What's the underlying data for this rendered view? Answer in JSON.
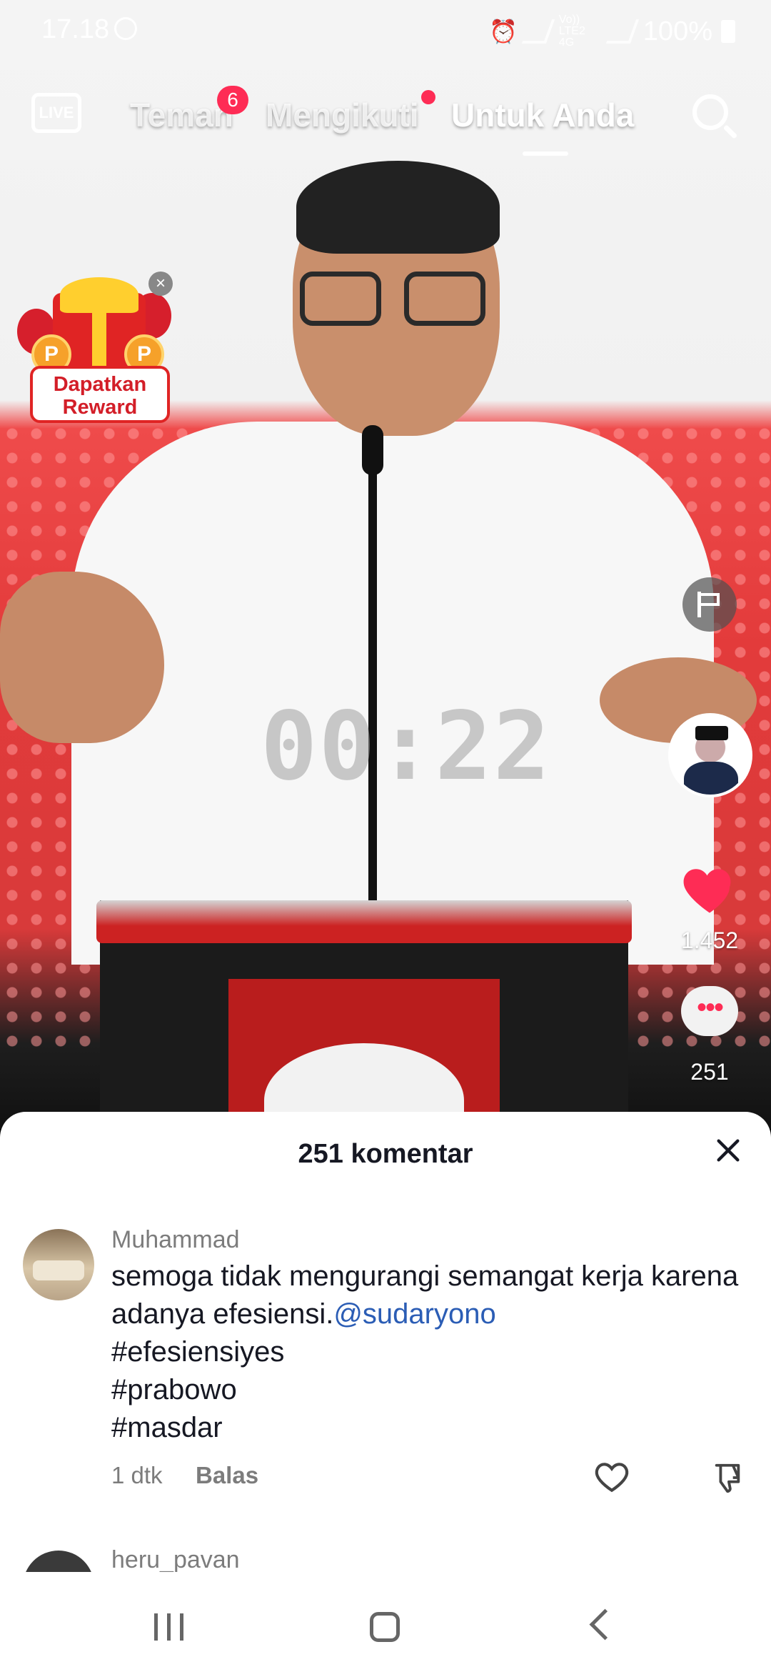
{
  "status_bar": {
    "time": "17.18",
    "network": "Vo)) LTE2 4G",
    "battery": "100%"
  },
  "top_nav": {
    "live_label": "LIVE",
    "tabs": [
      {
        "label": "Teman",
        "badge": "6"
      },
      {
        "label": "Mengikuti"
      },
      {
        "label": "Untuk Anda",
        "active": true
      }
    ]
  },
  "reward": {
    "line1": "Dapatkan",
    "line2": "Reward",
    "coin": "P"
  },
  "video": {
    "timer": "00:22",
    "likes": "1.452",
    "comments": "251"
  },
  "comments_sheet": {
    "title": "251 komentar",
    "comments": [
      {
        "user": "Muhammad",
        "text_before": "semoga tidak mengurangi semangat kerja karena adanya efesiensi.",
        "mention": "@sudaryono",
        "hashtags": [
          "#efesiensiyes",
          "#prabowo",
          "#masdar"
        ],
        "time": "1 dtk",
        "reply_label": "Balas"
      },
      {
        "user": "heru_pavan"
      }
    ]
  },
  "colors": {
    "accent": "#fe2c55",
    "mention": "#2b5db5",
    "reward_red": "#e02424"
  },
  "icons": {
    "search": "search-icon",
    "close": "close-icon",
    "flag": "flag-icon",
    "like": "heart-icon",
    "comment": "comment-icon",
    "dislike": "thumbs-down-icon"
  }
}
